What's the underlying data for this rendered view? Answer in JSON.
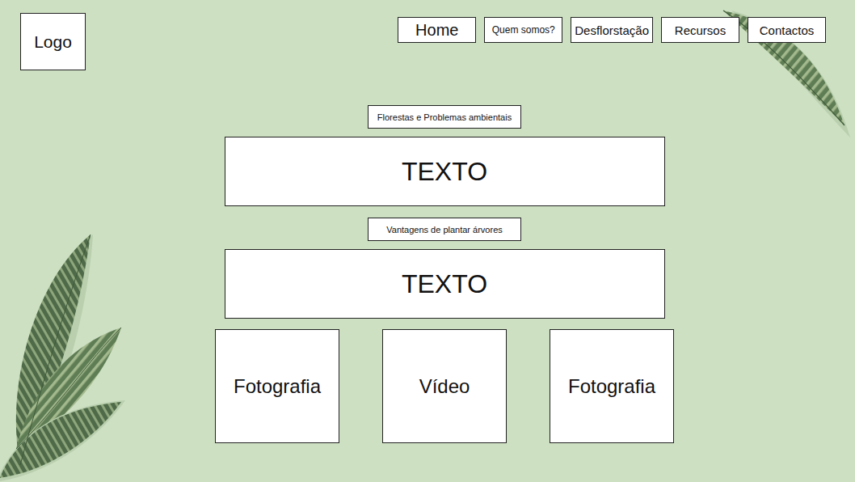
{
  "logo": "Logo",
  "nav": [
    "Home",
    "Quem somos?",
    "Desflorstação",
    "Recursos",
    "Contactos"
  ],
  "sections": [
    {
      "title": "Florestas e Problemas ambientais",
      "body": "TEXTO"
    },
    {
      "title": "Vantagens de plantar árvores",
      "body": "TEXTO"
    }
  ],
  "media": [
    "Fotografia",
    "Vídeo",
    "Fotografia"
  ]
}
